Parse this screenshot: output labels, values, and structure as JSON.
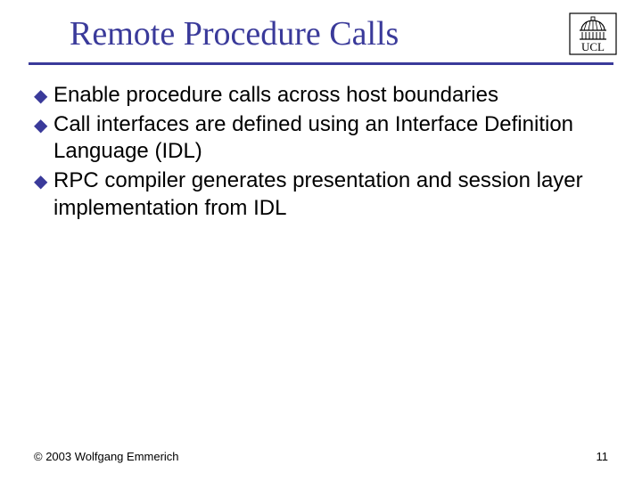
{
  "title": "Remote Procedure Calls",
  "logo_label": "UCL",
  "bullets": [
    "Enable procedure calls across host boundaries",
    "Call interfaces are defined using an Interface Definition Language (IDL)",
    "RPC compiler generates presentation and session layer implementation from IDL"
  ],
  "footer": {
    "copyright": "© 2003 Wolfgang Emmerich",
    "page": "11"
  },
  "colors": {
    "accent": "#3a3a9a"
  }
}
